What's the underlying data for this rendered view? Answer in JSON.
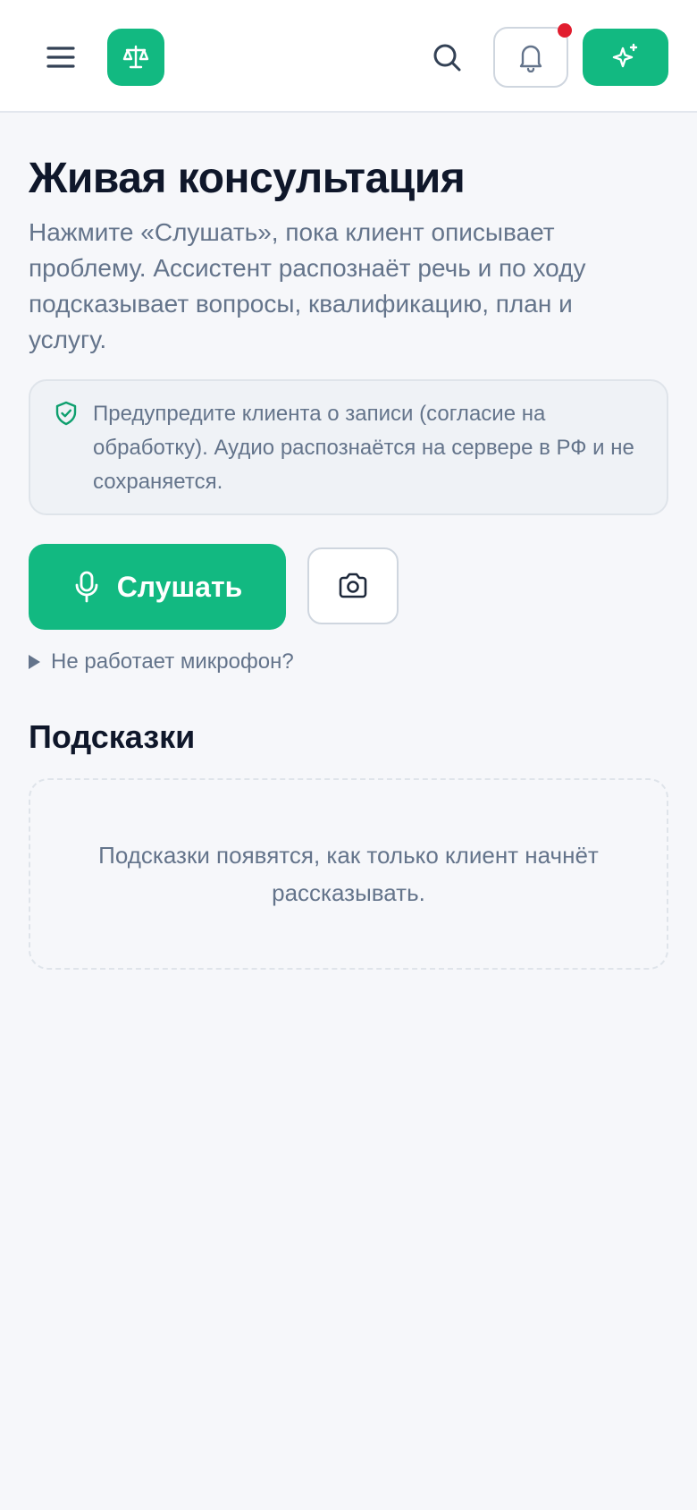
{
  "header": {
    "menu_icon": "menu-icon",
    "logo_icon": "scales-icon",
    "search_icon": "search-icon",
    "notifications_icon": "bell-icon",
    "notification_badge_color": "#e11d2e",
    "assistant_icon": "sparkles-icon",
    "accent_color": "#12b981"
  },
  "main": {
    "title": "Живая консультация",
    "intro": "Нажмите «Слушать», пока клиент описывает проблему. Ассистент распознаёт речь и по ходу подсказывает вопросы, квалификацию, план и услугу.",
    "notice": {
      "icon": "shield-check-icon",
      "text": "Предупредите клиента о записи (согласие на обработку). Аудио распознаётся на сервере в РФ и не сохраняется."
    },
    "actions": {
      "listen_label": "Слушать",
      "listen_icon": "microphone-icon",
      "camera_icon": "camera-icon"
    },
    "mic_help": "Не работает микрофон?",
    "hints": {
      "title": "Подсказки",
      "empty": "Подсказки появятся, как только клиент начнёт рассказывать."
    }
  }
}
